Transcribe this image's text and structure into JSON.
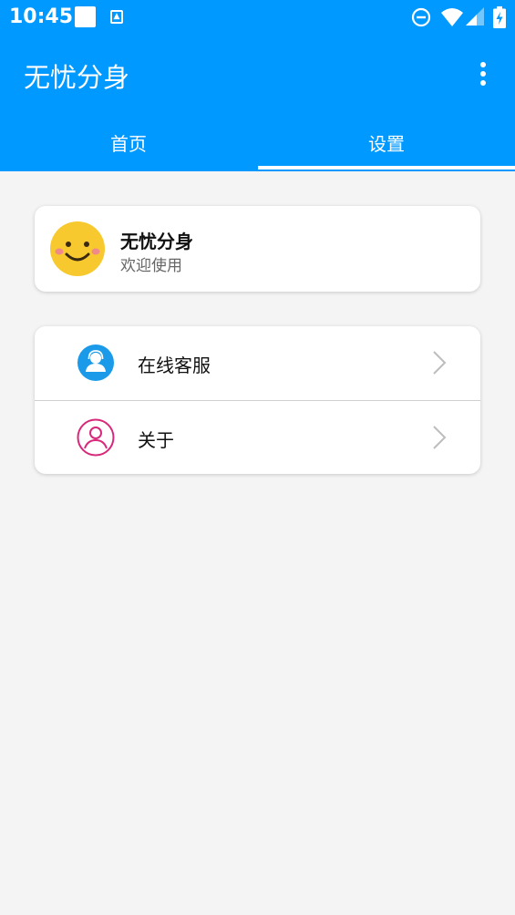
{
  "status_bar": {
    "time": "10:45",
    "icons": [
      "notification-square-icon",
      "a-badge-icon",
      "do-not-disturb-icon",
      "wifi-icon",
      "signal-icon",
      "battery-charging-icon"
    ]
  },
  "app_bar": {
    "title": "无忧分身",
    "menu_icon": "more-vert-icon",
    "background_color": "#0099ff"
  },
  "tabs": [
    {
      "label": "首页",
      "selected": false
    },
    {
      "label": "设置",
      "selected": true
    }
  ],
  "profile": {
    "avatar_icon": "smiley-face-icon",
    "name": "无忧分身",
    "subtitle": "欢迎使用"
  },
  "menu": [
    {
      "label": "在线客服",
      "icon": "customer-service-icon",
      "icon_color": "#1a9ae8"
    },
    {
      "label": "关于",
      "icon": "user-outline-icon",
      "icon_color": "#d8287a"
    }
  ]
}
